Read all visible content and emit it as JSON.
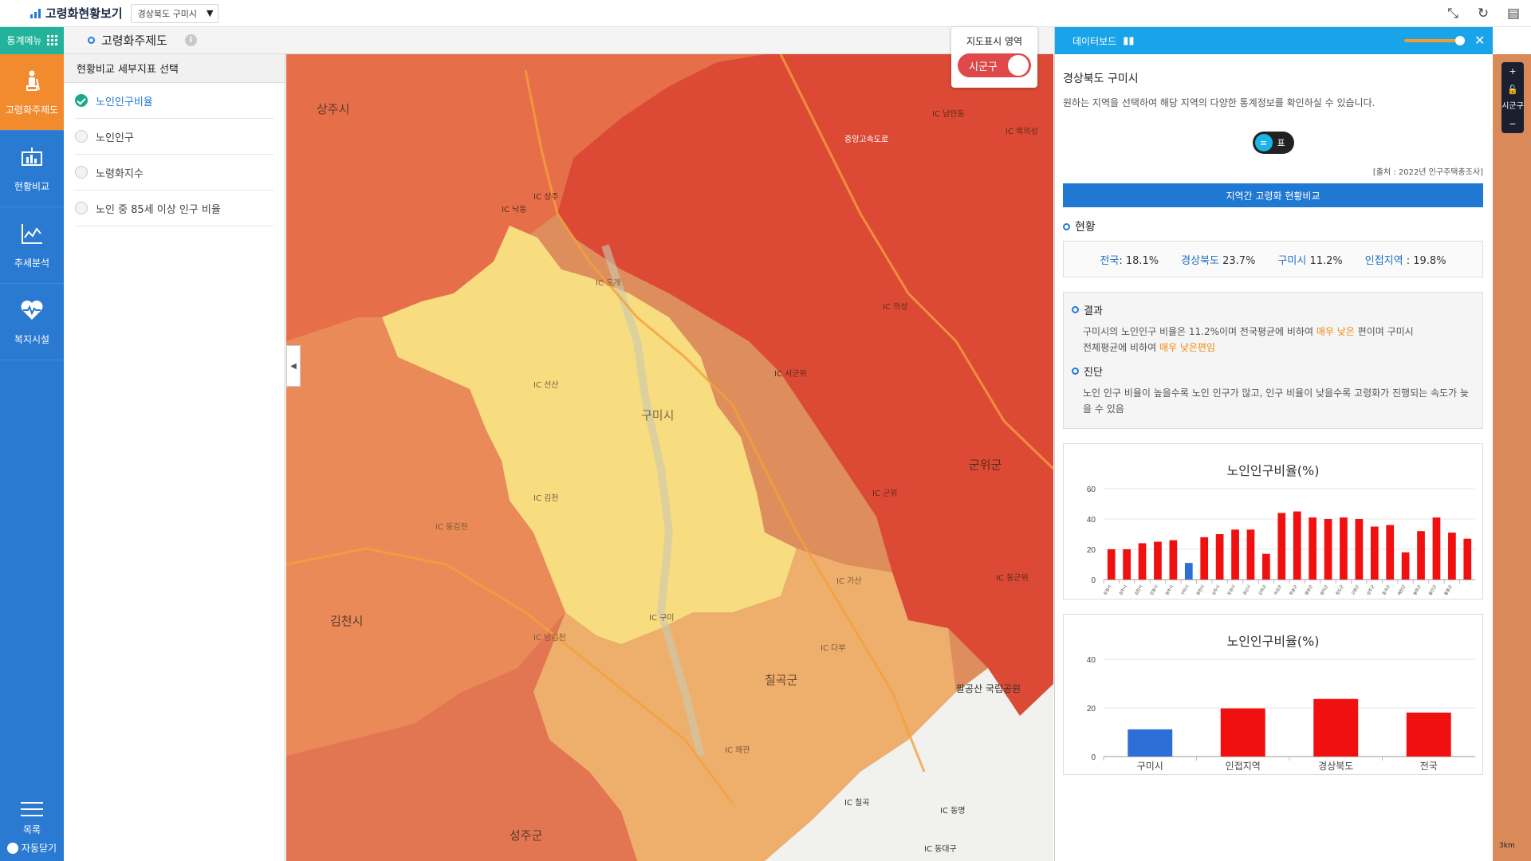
{
  "app": {
    "title": "고령화현황보기",
    "region": "경상북도 구미시"
  },
  "subbar": {
    "menu_label": "통계메뉴",
    "theme_tab": "고령화주제도",
    "info": "i"
  },
  "sidebar": {
    "items": [
      {
        "label": "고령화주제도",
        "icon": "elderly-icon"
      },
      {
        "label": "현황비교",
        "icon": "bar-chart-icon"
      },
      {
        "label": "추세분석",
        "icon": "line-chart-icon"
      },
      {
        "label": "복지시설",
        "icon": "heart-pulse-icon"
      }
    ],
    "list_label": "목록",
    "autoclose_label": "자동닫기"
  },
  "panel": {
    "title": "현황비교 세부지표 선택",
    "options": [
      {
        "label": "노인인구비율",
        "selected": true
      },
      {
        "label": "노인인구",
        "selected": false
      },
      {
        "label": "노령화지수",
        "selected": false
      },
      {
        "label": "노인 중 85세 이상 인구 비율",
        "selected": false
      }
    ]
  },
  "map": {
    "toggle_title": "지도표시 영역",
    "toggle_value": "시군구",
    "labels": [
      "상주시",
      "구미시",
      "군위군",
      "김천시",
      "칠곡군",
      "성주군",
      "팔공산 국립공원"
    ],
    "ic_labels": [
      "IC 도개",
      "IC 선산",
      "IC 김천",
      "IC 동김천",
      "IC 남김천",
      "IC 구미",
      "IC 가산",
      "IC 다부",
      "IC 칠곡",
      "IC 동명",
      "IC 서군위",
      "IC 군위",
      "IC 의성",
      "IC 동군위",
      "IC 남안동",
      "IC 북의성",
      "IC 상주",
      "IC 낙동",
      "IC 왜관",
      "IC 동대구"
    ],
    "road_label": "중앙고속도로"
  },
  "rightrail": {
    "zoom_in": "+",
    "lock_label": "시군구",
    "zoom_out": "−",
    "scale": "3km"
  },
  "dashboard": {
    "header": "데이터보드",
    "region_name": "경상북도 구미시",
    "region_desc": "원하는 지역을 선택하여 해당 지역의 다양한 통계정보를 확인하실 수 있습니다.",
    "view_label": "표",
    "source": "[출처 : 2022년 인구주택총조사]",
    "section_bar": "지역간 고령화 현황비교",
    "status_title": "현황",
    "stats": [
      {
        "key": "전국",
        "val": ": 18.1%"
      },
      {
        "key": "경상북도",
        "val": " 23.7%"
      },
      {
        "key": "구미시",
        "val": " 11.2%"
      },
      {
        "key": "인접지역",
        "val": " : 19.8%"
      }
    ],
    "result_title": "결과",
    "result_text_1": "구미시의 노인인구 비율은 11.2%이며 전국평균에 비하여 ",
    "result_hl_1": "매우 낮은",
    "result_text_2": " 편이며 구미시",
    "result_text_3": "전체평균에 비하여 ",
    "result_hl_2": "매우 낮은편임",
    "diag_title": "진단",
    "diag_text": "노인 인구 비율이 높을수록 노인 인구가 많고, 인구 비율이 낮을수록 고령화가 진행되는 속도가 늦을 수 있음"
  },
  "chart_data": [
    {
      "type": "bar",
      "title": "노인인구비율(%)",
      "ylim": [
        0,
        60
      ],
      "yticks": [
        0,
        20,
        40,
        60
      ],
      "highlight_color": "#2d6fd6",
      "bar_color": "#f01010",
      "highlight_index": 5,
      "categories": [
        "포항시",
        "경주시",
        "김천시",
        "안동시",
        "영주시",
        "구미시",
        "영천시",
        "상주시",
        "문경시",
        "경산시",
        "군위군",
        "의성군",
        "청송군",
        "영양군",
        "영덕군",
        "청도군",
        "고령군",
        "성주군",
        "칠곡군",
        "예천군",
        "봉화군",
        "울진군",
        "울릉군"
      ],
      "values": [
        20,
        20,
        24,
        25,
        26,
        11,
        28,
        30,
        33,
        33,
        17,
        44,
        45,
        41,
        40,
        41,
        40,
        35,
        36,
        18,
        32,
        41,
        31,
        27
      ]
    },
    {
      "type": "bar",
      "title": "노인인구비율(%)",
      "ylim": [
        0,
        40
      ],
      "yticks": [
        0,
        20,
        40
      ],
      "categories": [
        "구미시",
        "인접지역",
        "경상북도",
        "전국"
      ],
      "values": [
        11.2,
        19.8,
        23.7,
        18.1
      ],
      "colors": [
        "#2d6fd6",
        "#f01010",
        "#f01010",
        "#f01010"
      ]
    }
  ]
}
